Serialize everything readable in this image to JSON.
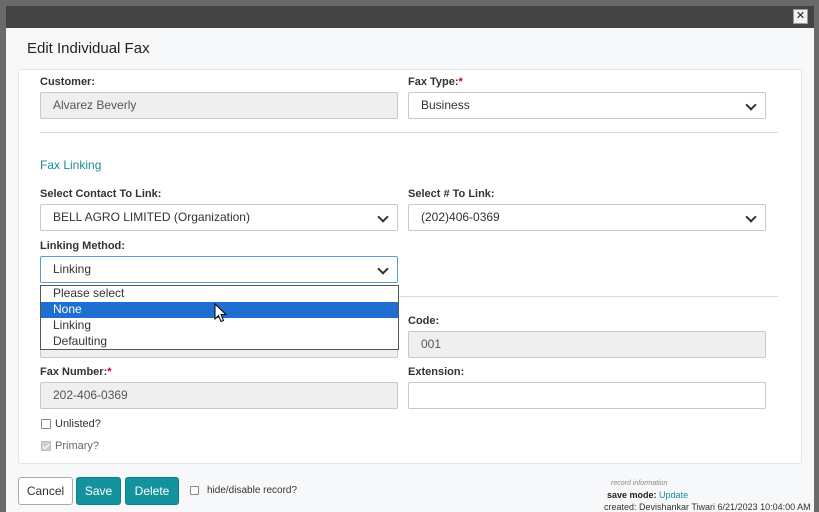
{
  "dialog": {
    "title": "Edit Individual Fax",
    "close_symbol": "✕"
  },
  "form": {
    "customer_label": "Customer:",
    "customer_value": "Alvarez Beverly",
    "fax_type_label": "Fax Type:",
    "fax_type_value": "Business",
    "required_marker": "*",
    "section_fax_linking": "Fax Linking",
    "contact_label": "Select Contact To Link:",
    "contact_value": "BELL AGRO LIMITED (Organization)",
    "number_label": "Select # To Link:",
    "number_value": "(202)406-0369",
    "linking_method_label": "Linking Method:",
    "linking_method_value": "Linking",
    "code_label": "Code:",
    "code_value": "001",
    "fax_number_label": "Fax Number:",
    "fax_number_value": "202-406-0369",
    "extension_label": "Extension:",
    "extension_value": "",
    "unlisted_label": "Unlisted?",
    "primary_label": "Primary?"
  },
  "linking_dropdown": {
    "options": [
      "Please select",
      "None",
      "Linking",
      "Defaulting"
    ],
    "highlighted_index": 1
  },
  "footer": {
    "cancel_label": "Cancel",
    "save_label": "Save",
    "delete_label": "Delete",
    "hide_label": "hide/disable record?",
    "record_info_label": "record information",
    "save_mode_label": "save mode:",
    "save_mode_value": "Update",
    "created_text": "created: Devishankar Tiwari 6/21/2023 10:04:00 AM"
  },
  "colors": {
    "accent": "#14939e",
    "link": "#1a8a9a",
    "highlight": "#1e6fcf",
    "required": "#d0021b"
  }
}
